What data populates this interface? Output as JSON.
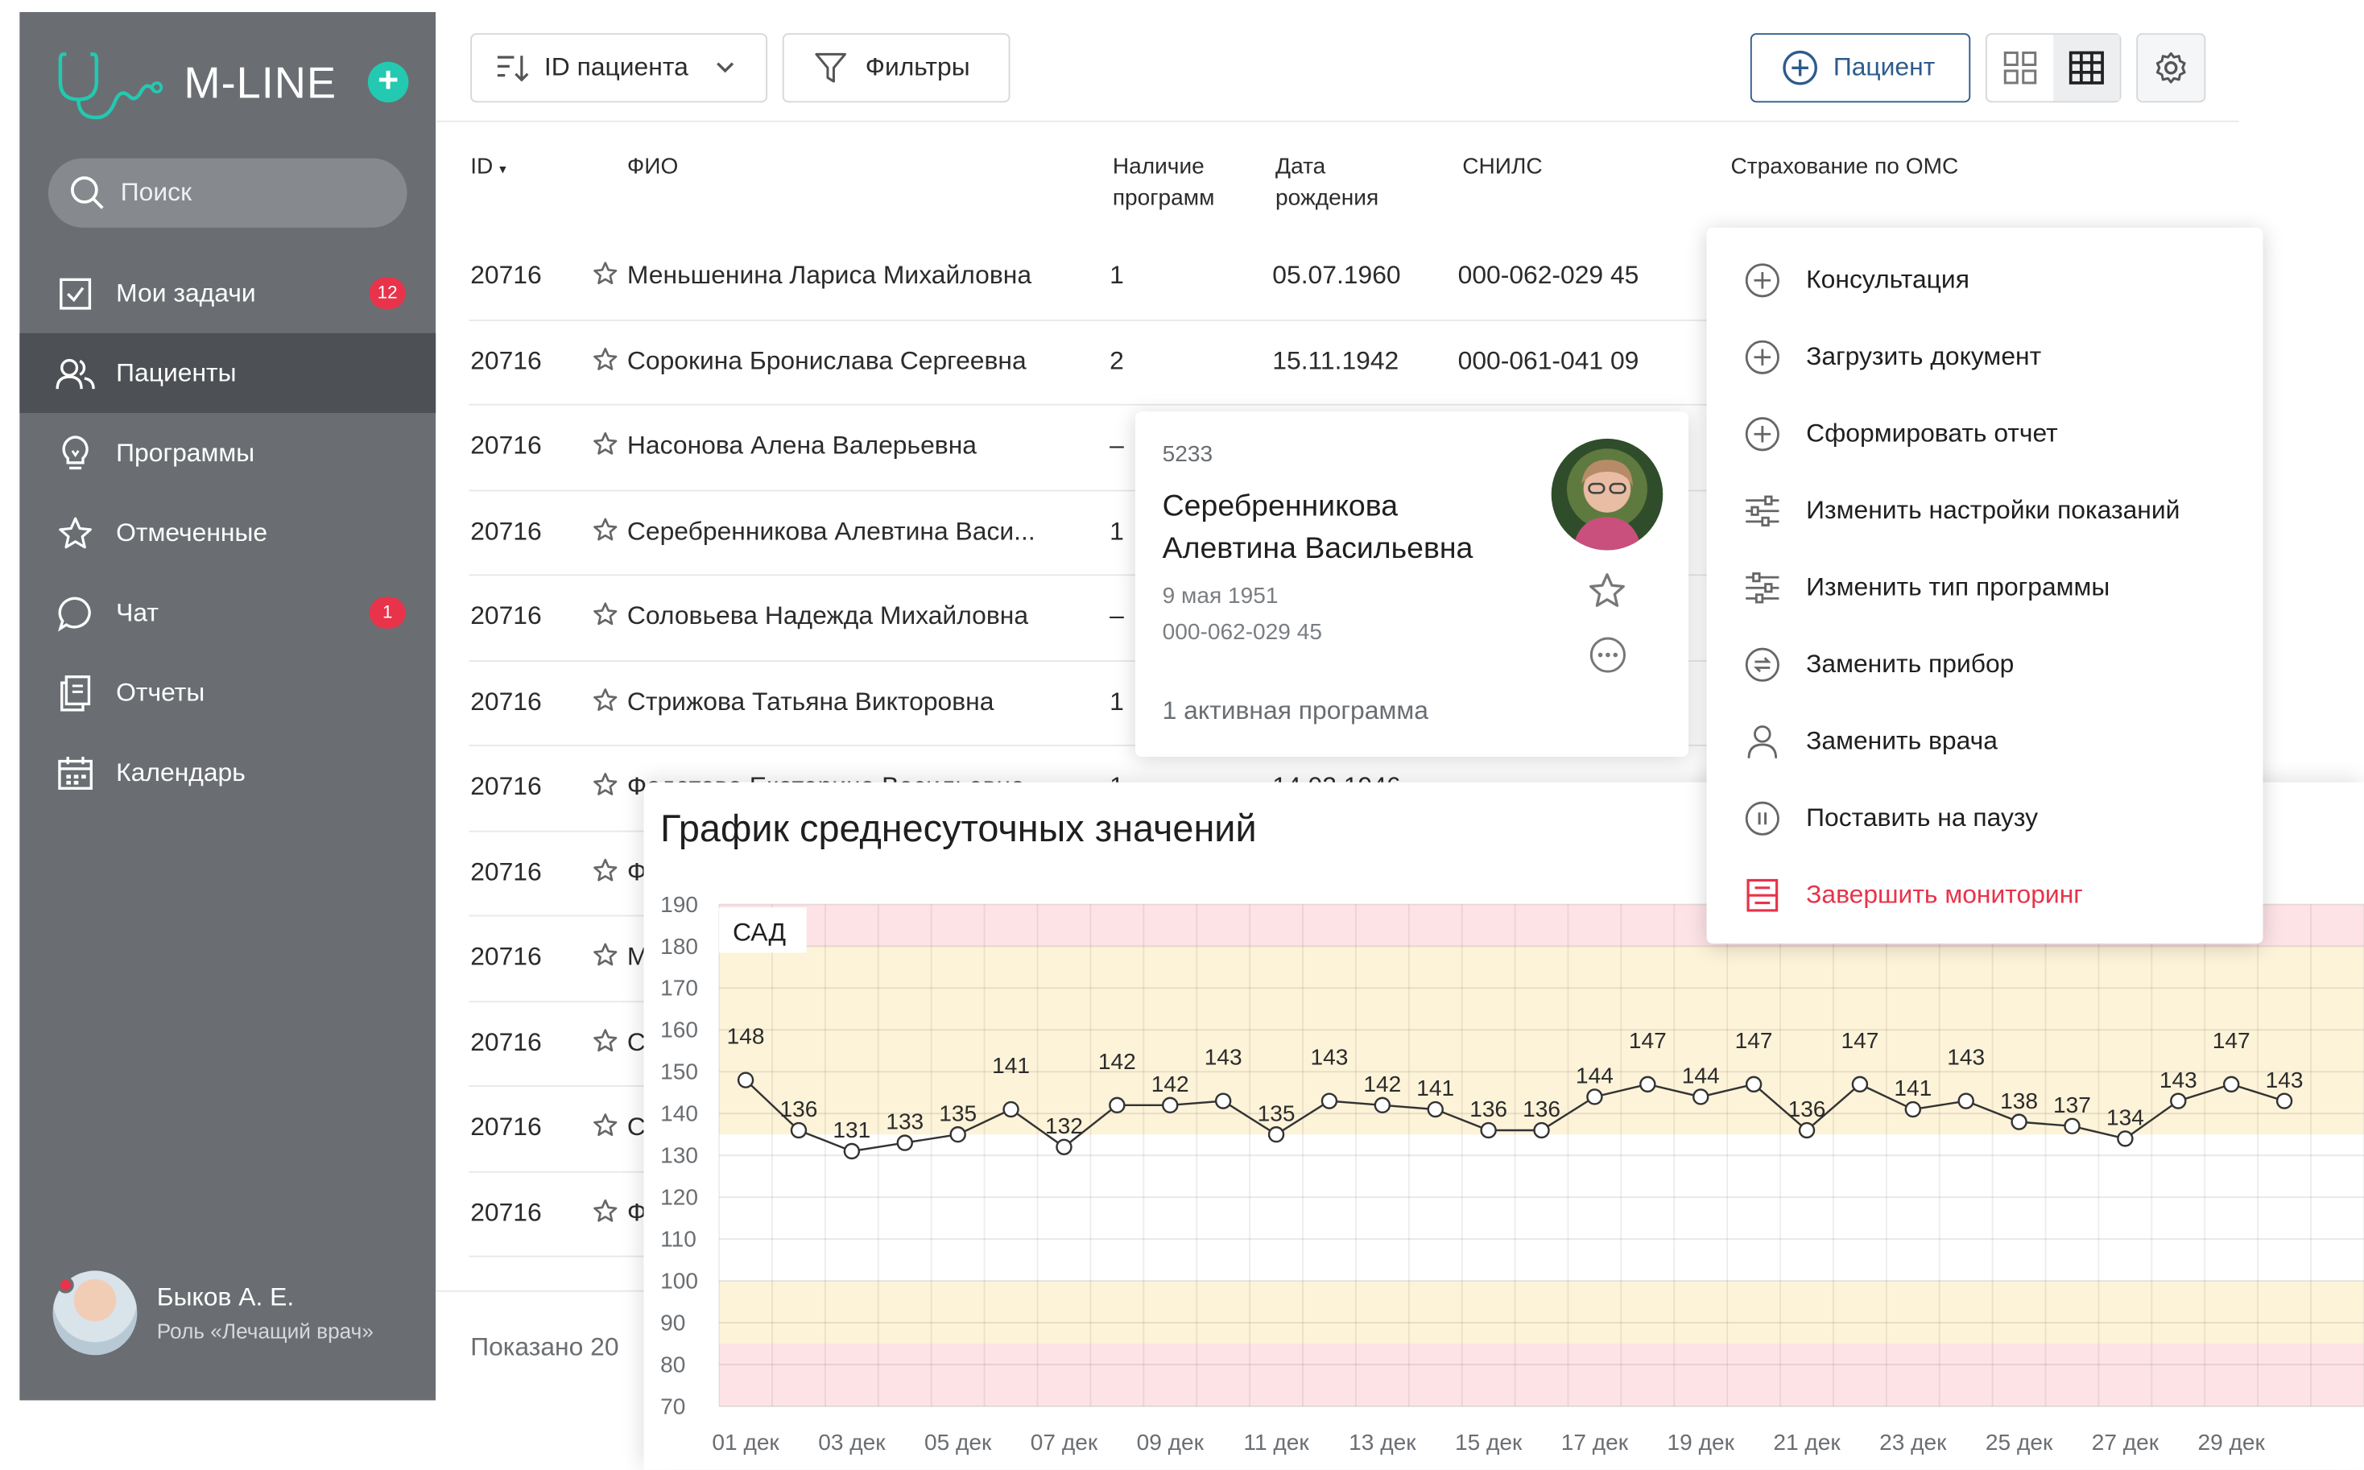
{
  "app": {
    "logo_text": "M-LINE",
    "brand_color": "#23c9b0"
  },
  "sidebar": {
    "search_placeholder": "Поиск",
    "items": [
      {
        "label": "Мои задачи",
        "icon": "checkbox-icon",
        "badge": "12"
      },
      {
        "label": "Пациенты",
        "icon": "users-icon",
        "active": true
      },
      {
        "label": "Программы",
        "icon": "lightbulb-icon"
      },
      {
        "label": "Отмеченные",
        "icon": "star-icon"
      },
      {
        "label": "Чат",
        "icon": "chat-bubble-icon",
        "badge": "1"
      },
      {
        "label": "Отчеты",
        "icon": "report-icon"
      },
      {
        "label": "Календарь",
        "icon": "calendar-icon"
      }
    ],
    "user": {
      "name": "Быков А. Е.",
      "role": "Роль «Лечащий врач»"
    }
  },
  "toolbar": {
    "sort_label": "ID пациента",
    "filters_label": "Фильтры",
    "add_patient_label": "Пациент"
  },
  "table": {
    "columns": {
      "id": "ID",
      "fio": "ФИО",
      "programs_line1": "Наличие",
      "programs_line2": "программ",
      "dob_line1": "Дата",
      "dob_line2": "рождения",
      "snils": "СНИЛС",
      "oms": "Страхование по ОМС"
    },
    "rows": [
      {
        "id": "20716",
        "name": "Меньшенина Лариса Михайловна",
        "programs": "1",
        "dob": "05.07.1960",
        "snils": "000-062-029 45"
      },
      {
        "id": "20716",
        "name": "Сорокина Бронислава Сергеевна",
        "programs": "2",
        "dob": "15.11.1942",
        "snils": "000-061-041 09"
      },
      {
        "id": "20716",
        "name": "Насонова Алена Валерьевна",
        "programs": "–",
        "dob": "",
        "snils": ""
      },
      {
        "id": "20716",
        "name": "Серебренникова Алевтина Васи...",
        "programs": "1",
        "dob": "",
        "snils": ""
      },
      {
        "id": "20716",
        "name": "Соловьева Надежда Михайловна",
        "programs": "–",
        "dob": "",
        "snils": ""
      },
      {
        "id": "20716",
        "name": "Стрижова Татьяна Викторовна",
        "programs": "1",
        "dob": "",
        "snils": ""
      },
      {
        "id": "20716",
        "name": "Федотова Екатерина Васильевна",
        "programs": "1",
        "dob": "14.02.1946",
        "snils": ""
      },
      {
        "id": "20716",
        "name": "Ф",
        "programs": "",
        "dob": "",
        "snils": ""
      },
      {
        "id": "20716",
        "name": "М",
        "programs": "",
        "dob": "",
        "snils": ""
      },
      {
        "id": "20716",
        "name": "С",
        "programs": "",
        "dob": "",
        "snils": ""
      },
      {
        "id": "20716",
        "name": "С",
        "programs": "",
        "dob": "",
        "snils": ""
      },
      {
        "id": "20716",
        "name": "Ф",
        "programs": "",
        "dob": "",
        "snils": ""
      }
    ],
    "footer": "Показано 20"
  },
  "patient_card": {
    "id": "5233",
    "name": "Серебренникова Алевтина Васильевна",
    "dob": "9 мая 1951",
    "snils": "000-062-029 45",
    "programs": "1 активная программа"
  },
  "context_menu": [
    {
      "label": "Консультация",
      "icon": "plus-circle-icon"
    },
    {
      "label": "Загрузить документ",
      "icon": "plus-circle-icon"
    },
    {
      "label": "Сформировать отчет",
      "icon": "plus-circle-icon"
    },
    {
      "label": "Изменить настройки показаний",
      "icon": "sliders-icon"
    },
    {
      "label": "Изменить тип программы",
      "icon": "sliders-icon"
    },
    {
      "label": "Заменить прибор",
      "icon": "swap-icon"
    },
    {
      "label": "Заменить врача",
      "icon": "person-icon"
    },
    {
      "label": "Поставить на паузу",
      "icon": "pause-icon"
    },
    {
      "label": "Завершить мониторинг",
      "icon": "stop-icon",
      "danger": true
    }
  ],
  "chart_data": {
    "type": "line",
    "title": "График среднесуточных значений",
    "series_label": "САД",
    "ylim": [
      70,
      190
    ],
    "yticks": [
      70,
      80,
      90,
      100,
      110,
      120,
      130,
      140,
      150,
      160,
      170,
      180,
      190
    ],
    "x_tick_labels": [
      "01 дек",
      "03 дек",
      "05 дек",
      "07 дек",
      "09 дек",
      "11 дек",
      "13 дек",
      "15 дек",
      "17 дек",
      "19 дек",
      "21 дек",
      "23 дек",
      "25 дек",
      "27 дек",
      "29 дек"
    ],
    "bands": [
      {
        "from": 180,
        "to": 190,
        "color": "#fde3e6"
      },
      {
        "from": 135,
        "to": 180,
        "color": "#fdf3d9"
      },
      {
        "from": 85,
        "to": 100,
        "color": "#fdf3d9"
      },
      {
        "from": 70,
        "to": 85,
        "color": "#fde3e6"
      }
    ],
    "x": [
      1,
      2,
      3,
      4,
      5,
      6,
      7,
      8,
      9,
      10,
      11,
      12,
      13,
      14,
      15,
      16,
      17,
      18,
      19,
      20,
      21,
      22,
      23,
      24,
      25,
      26,
      27,
      28,
      29,
      30
    ],
    "values": [
      148,
      136,
      131,
      133,
      135,
      141,
      132,
      142,
      142,
      143,
      135,
      143,
      142,
      141,
      136,
      136,
      144,
      147,
      144,
      147,
      136,
      147,
      141,
      143,
      138,
      137,
      134,
      143,
      147,
      143
    ],
    "grid": true
  }
}
